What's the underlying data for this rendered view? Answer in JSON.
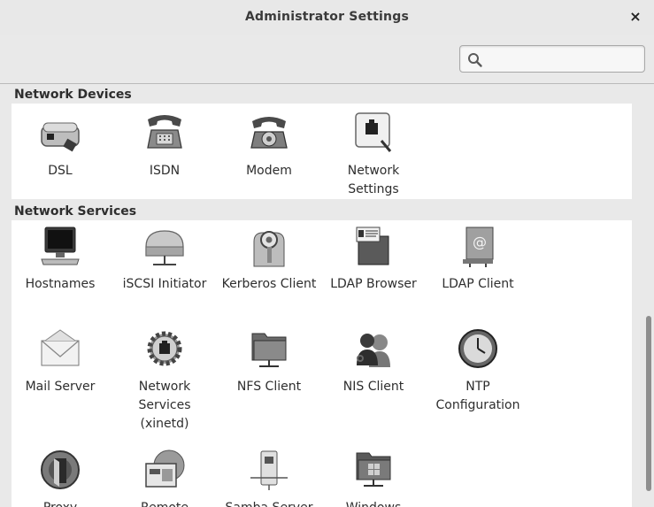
{
  "window": {
    "title": "Administrator Settings",
    "close_glyph": "×"
  },
  "search": {
    "placeholder": "",
    "value": "",
    "icon": "search-icon"
  },
  "sections": [
    {
      "title": "Network Devices",
      "items": [
        {
          "label": "DSL",
          "icon": "dsl-modem-icon"
        },
        {
          "label": "ISDN",
          "icon": "isdn-phone-icon"
        },
        {
          "label": "Modem",
          "icon": "modem-phone-icon"
        },
        {
          "label": "Network Settings",
          "icon": "network-settings-icon"
        }
      ]
    },
    {
      "title": "Network Services",
      "items": [
        {
          "label": "Hostnames",
          "icon": "hostnames-monitor-icon"
        },
        {
          "label": "iSCSI Initiator",
          "icon": "iscsi-drive-icon"
        },
        {
          "label": "Kerberos Client",
          "icon": "kerberos-key-icon"
        },
        {
          "label": "LDAP Browser",
          "icon": "ldap-browser-icon"
        },
        {
          "label": "LDAP Client",
          "icon": "ldap-client-icon"
        },
        {
          "label": "Mail Server",
          "icon": "mail-envelope-icon"
        },
        {
          "label": "Network Services (xinetd)",
          "icon": "gear-network-icon"
        },
        {
          "label": "NFS Client",
          "icon": "nfs-folder-icon"
        },
        {
          "label": "NIS Client",
          "icon": "nis-users-icon"
        },
        {
          "label": "NTP Configuration",
          "icon": "ntp-clock-icon"
        },
        {
          "label": "Proxy",
          "icon": "proxy-globe-icon"
        },
        {
          "label": "Remote",
          "icon": "remote-admin-icon"
        },
        {
          "label": "Samba Server",
          "icon": "samba-server-icon"
        },
        {
          "label": "Windows",
          "icon": "windows-folder-icon"
        }
      ]
    }
  ]
}
